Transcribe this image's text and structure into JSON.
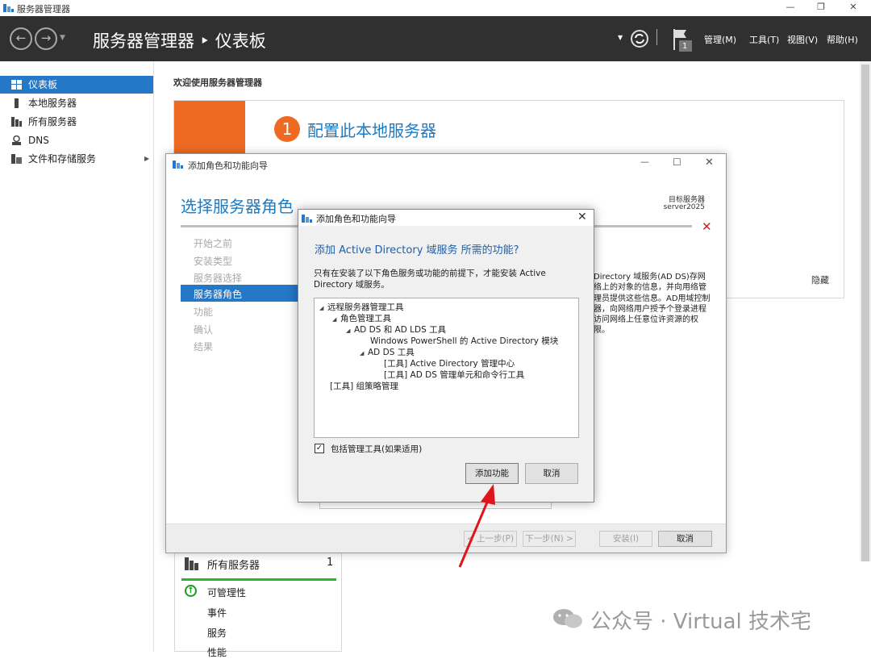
{
  "window": {
    "title": "服务器管理器",
    "controls": {
      "minimize": "—",
      "restore": "❐",
      "close": "✕"
    }
  },
  "header": {
    "breadcrumb": "服务器管理器 ‣ 仪表板",
    "notification_count": "1",
    "menus": [
      "管理(M)",
      "工具(T)",
      "视图(V)",
      "帮助(H)"
    ]
  },
  "sidebar": {
    "items": [
      {
        "label": "仪表板",
        "icon": "dashboard-icon",
        "active": true
      },
      {
        "label": "本地服务器",
        "icon": "server-icon",
        "active": false
      },
      {
        "label": "所有服务器",
        "icon": "servers-icon",
        "active": false
      },
      {
        "label": "DNS",
        "icon": "dns-icon",
        "active": false
      },
      {
        "label": "文件和存储服务",
        "icon": "storage-icon",
        "active": false,
        "has_submenu": true
      }
    ]
  },
  "main": {
    "welcome": "欢迎使用服务器管理器",
    "quick_start": {
      "step_number": "1",
      "step_text": "配置此本地服务器",
      "hide": "隐藏"
    },
    "tile": {
      "title": "所有服务器",
      "count": "1",
      "rows": [
        "可管理性",
        "事件",
        "服务",
        "性能"
      ]
    }
  },
  "wizard": {
    "title": "添加角色和功能向导",
    "heading": "选择服务器角色",
    "target_label": "目标服务器",
    "target_server": "server2025",
    "steps": [
      "开始之前",
      "安装类型",
      "服务器选择",
      "服务器角色",
      "功能",
      "确认",
      "结果"
    ],
    "active_step": "服务器角色",
    "description": "Directory 域服务(AD DS)存网络上的对象的信息，并向用络管理员提供这些信息。AD用域控制器，向网络用户授予个登录进程访问网络上任意位许资源的权限。",
    "buttons": {
      "prev": "< 上一步(P)",
      "next": "下一步(N) >",
      "install": "安装(I)",
      "cancel": "取消"
    }
  },
  "dialog": {
    "title": "添加角色和功能向导",
    "heading": "添加 Active Directory 域服务 所需的功能?",
    "description": "只有在安装了以下角色服务或功能的前提下，才能安装 Active Directory 域服务。",
    "tree": [
      {
        "label": "远程服务器管理工具",
        "level": 0,
        "expand": true
      },
      {
        "label": "角色管理工具",
        "level": 1,
        "expand": true
      },
      {
        "label": "AD DS 和 AD LDS 工具",
        "level": 2,
        "expand": true
      },
      {
        "label": "Windows PowerShell 的 Active Directory 模块",
        "level": 3,
        "expand": false
      },
      {
        "label": "AD DS 工具",
        "level": 3,
        "expand": true
      },
      {
        "label": "[工具] Active Directory 管理中心",
        "level": 4,
        "expand": false
      },
      {
        "label": "[工具] AD DS 管理单元和命令行工具",
        "level": 4,
        "expand": false
      },
      {
        "label": "[工具] 组策略管理",
        "level": 0,
        "expand": false
      }
    ],
    "checkbox_label": "包括管理工具(如果适用)",
    "checkbox_checked": true,
    "add_button": "添加功能",
    "cancel_button": "取消"
  },
  "watermark": "公众号 · Virtual 技术宅",
  "colors": {
    "accent": "#2577c8",
    "orange": "#ee6a22",
    "header_bg": "#303030",
    "red_arrow": "#e0151b"
  }
}
